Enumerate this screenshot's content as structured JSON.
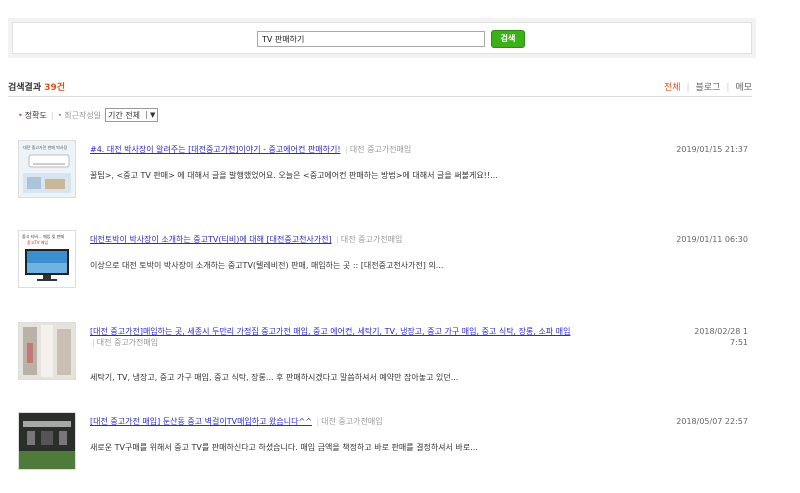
{
  "search": {
    "query": "TV 판매하기",
    "button_label": "검색"
  },
  "results_header": {
    "title": "검색결과",
    "count": "39건",
    "tabs": [
      "전체",
      "블로그",
      "메모"
    ],
    "active_tab": "전체"
  },
  "sort": {
    "options": [
      "정확도",
      "최근작성일"
    ],
    "period_select": "기간 전체"
  },
  "results": [
    {
      "title": "#4. 대전 박사장이 알려주는 [대전중고가전]이야기 - 중고에어컨 판매하기!",
      "source": "대전 중고가전매입",
      "date": "2019/01/15 21:37",
      "snippet": "꿀팁>, <중고 TV 판매> 에 대해서 글을 발행했었어요. 오늘은 <중고에어컨 판매하는 방법>에 대해서 글을 써볼게요!!..."
    },
    {
      "title": "대전토박이 박사장이 소개하는 중고TV(티비)에 대해 [대전중고천사가전]",
      "source": "대전 중고가전매입",
      "date": "2019/01/11 06:30",
      "snippet": "이상으로 대전 토박이 박사장이 소개하는 중고TV(텔레비전) 판매, 매입하는 곳 :: [대전중고천사가전] 의..."
    },
    {
      "title": "[대전 중고가전]매입하는 곳, 세종시 두만리 가정집 중고가전 매입, 중고 에어컨, 세탁기, TV, 냉장고, 중고 가구 매입, 중고 식탁, 장롱, 소파 매입",
      "source": "대전 중고가전매입",
      "date_line1": "2018/02/28 1",
      "date_line2": "7:51",
      "snippet": "세탁기, TV, 냉장고, 중고 가구 매입, 중고 식탁, 장롱... 후 판매하시겠다고 말씀하셔서 예약만 잡아놓고 있던..."
    },
    {
      "title": "[대전 중고가전 매입] 둔산동 중고 벽걸이TV매입하고 왔습니다^^",
      "source": "대전 중고가전매입",
      "date": "2018/05/07 22:57",
      "snippet": "새로운 TV구매를 위해서 중고 TV를 판매하신다고 하셨습니다. 매입 금액을 책정하고 바로 판매를 결정하셔서 바로..."
    }
  ],
  "thumb_captions": {
    "t1_top": "대전 중고가전 판매 박사장",
    "t2_top": "중고 티비... 매입 및 판매",
    "t2_red": "중고TV 매입"
  }
}
